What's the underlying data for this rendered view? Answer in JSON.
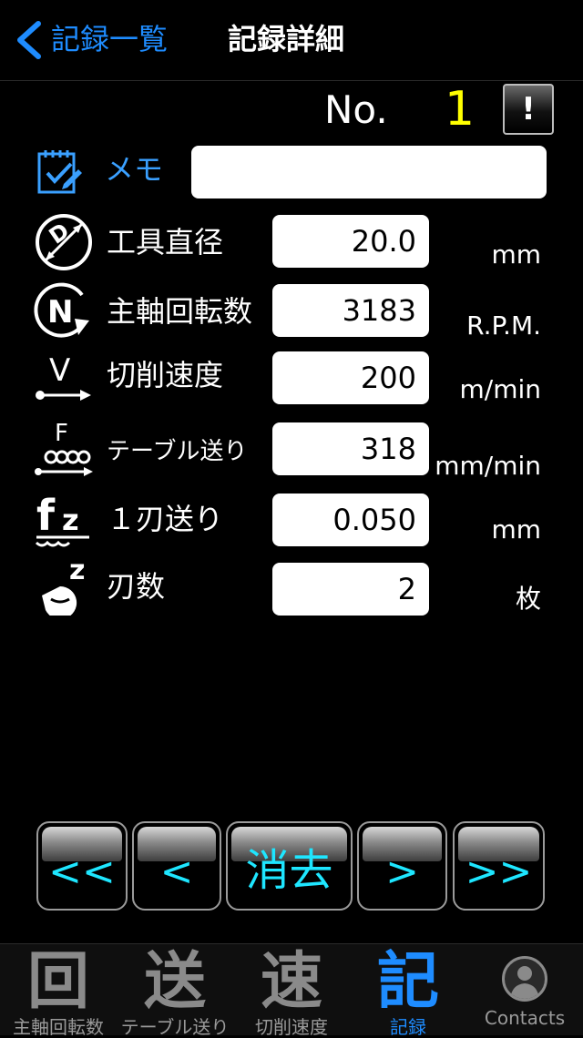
{
  "nav": {
    "back_label": "記録一覧",
    "title": "記録詳細"
  },
  "record": {
    "no_label": "No.",
    "no_value": "1",
    "alert_label": "!"
  },
  "memo": {
    "label": "メモ",
    "value": "",
    "placeholder": ""
  },
  "rows": [
    {
      "label": "工具直径",
      "value": "20.0",
      "unit": "mm",
      "icon": "diameter-icon"
    },
    {
      "label": "主軸回転数",
      "value": "3183",
      "unit": "R.P.M.",
      "icon": "spindle-rpm-icon"
    },
    {
      "label": "切削速度",
      "value": "200",
      "unit": "m/min",
      "icon": "cutting-speed-icon"
    },
    {
      "label": "テーブル送り",
      "value": "318",
      "unit": "mm/min",
      "icon": "table-feed-icon"
    },
    {
      "label": "１刃送り",
      "value": "0.050",
      "unit": "mm",
      "icon": "feed-per-tooth-icon"
    },
    {
      "label": "刃数",
      "value": "2",
      "unit": "枚",
      "icon": "teeth-count-icon"
    }
  ],
  "buttons": {
    "first": "<<",
    "prev": "<",
    "clear": "消去",
    "next": ">",
    "last": ">>"
  },
  "tabs": [
    {
      "glyph": "回",
      "label": "主軸回転数"
    },
    {
      "glyph": "送",
      "label": "テーブル送り"
    },
    {
      "glyph": "速",
      "label": "切削速度"
    },
    {
      "glyph": "記",
      "label": "記録",
      "active": true
    },
    {
      "glyph": "",
      "label": "Contacts"
    }
  ],
  "colors": {
    "accent": "#1e8cff",
    "number": "#ffff00",
    "button_text": "#1ee6ff",
    "background": "#000000"
  }
}
